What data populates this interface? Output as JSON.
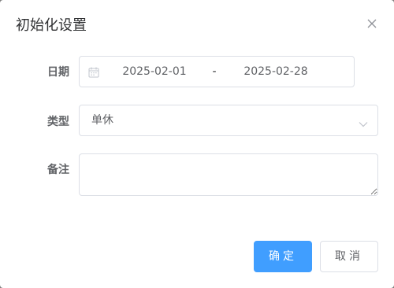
{
  "dialog": {
    "title": "初始化设置"
  },
  "form": {
    "date": {
      "label": "日期",
      "start": "2025-02-01",
      "separator": "-",
      "end": "2025-02-28"
    },
    "type": {
      "label": "类型",
      "value": "单休"
    },
    "remark": {
      "label": "备注",
      "value": ""
    }
  },
  "footer": {
    "confirm_label": "确定",
    "cancel_label": "取消"
  },
  "colors": {
    "primary": "#409eff",
    "border": "#dcdfe6",
    "text": "#606266"
  },
  "icons": {
    "close": "close-icon",
    "calendar": "calendar-icon",
    "dropdown": "chevron-down-icon"
  }
}
